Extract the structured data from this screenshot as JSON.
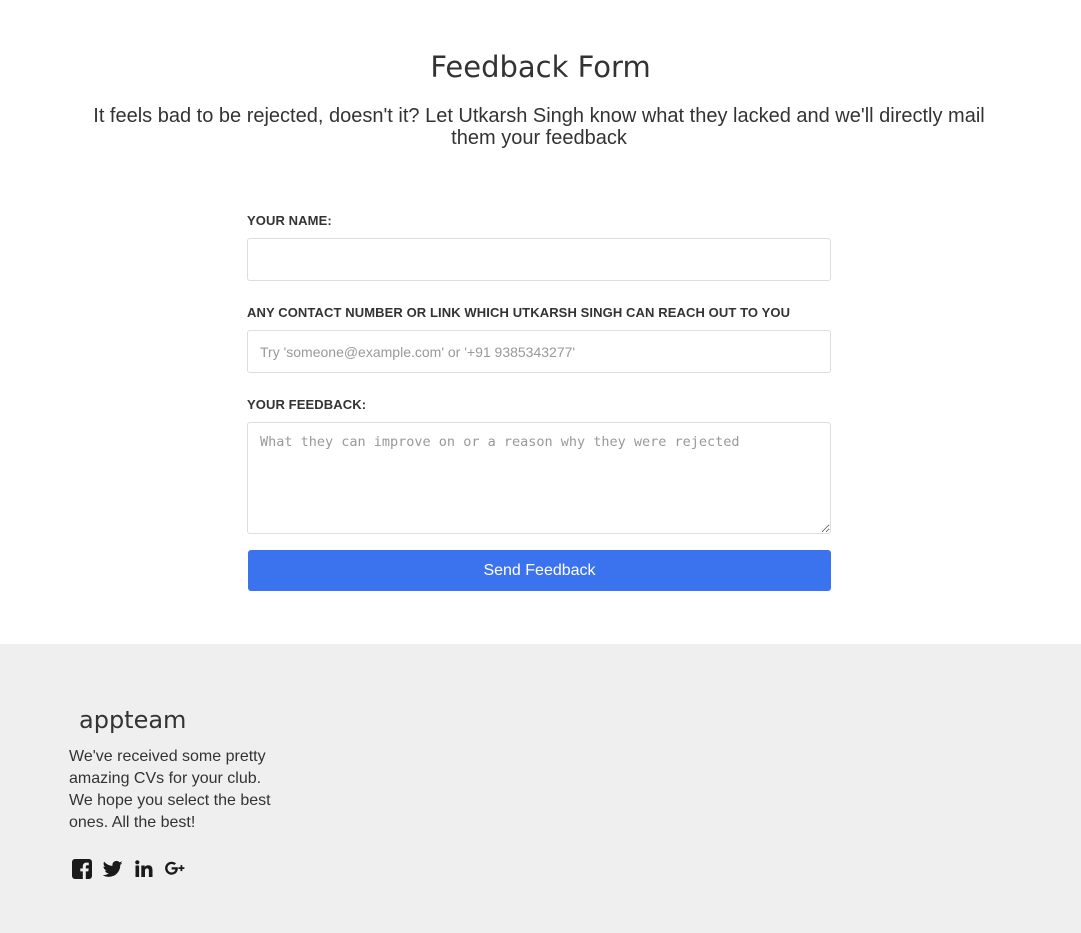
{
  "header": {
    "title": "Feedback Form",
    "subtitle": "It feels bad to be rejected, doesn't it? Let Utkarsh Singh know what they lacked and we'll directly mail them your feedback"
  },
  "form": {
    "name_label": "YOUR NAME:",
    "name_value": "",
    "name_placeholder": "",
    "contact_label": "ANY CONTACT NUMBER OR LINK WHICH UTKARSH SINGH CAN REACH OUT TO YOU",
    "contact_value": "",
    "contact_placeholder": "Try 'someone@example.com' or '+91 9385343277'",
    "feedback_label": "YOUR FEEDBACK:",
    "feedback_value": "",
    "feedback_placeholder": "What they can improve on or a reason why they were rejected",
    "submit_label": "Send Feedback"
  },
  "footer": {
    "brand": "appteam",
    "blurb": "We've received some pretty amazing CVs for your club. We hope you select the best ones. All the best!",
    "social_icons": [
      "facebook-icon",
      "twitter-icon",
      "linkedin-icon",
      "google-plus-icon"
    ]
  },
  "colors": {
    "accent": "#3b73ef",
    "footer_bg": "#efefef",
    "text": "#333333"
  }
}
